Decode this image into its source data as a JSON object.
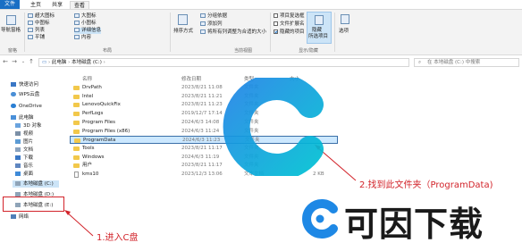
{
  "ribbon": {
    "tabs": [
      "文件",
      "主页",
      "共享",
      "查看"
    ],
    "pane_group": {
      "nav_pane": "导航窗格",
      "label": "窗格"
    },
    "layout_group": {
      "items": [
        "超大图标",
        "大图标",
        "中图标",
        "小图标",
        "列表",
        "详细信息",
        "平铺",
        "内容"
      ],
      "label": "布局"
    },
    "current_view": {
      "sort": "排序方式",
      "group_by": "分组依据",
      "add_columns": "添加列",
      "fit_columns": "将所有列调整为合适的大小",
      "label": "当前视图"
    },
    "show_hide": {
      "item_checkbox": "项目复选框",
      "file_ext": "文件扩展名",
      "hidden_items": "隐藏的项目",
      "hide_selected": "隐藏",
      "hide_selected_2": "所选项目",
      "label": "显示/隐藏"
    },
    "options": "选项"
  },
  "address": {
    "path": [
      "此电脑",
      "本地磁盘 (C:)"
    ],
    "search_placeholder": "在 本地磁盘 (C:) 中搜索"
  },
  "nav": {
    "items": [
      "快速访问",
      "WPS云盘",
      "OneDrive",
      "此电脑",
      "3D 对象",
      "视频",
      "图片",
      "文档",
      "下载",
      "音乐",
      "桌面",
      "本地磁盘 (C:)",
      "本地磁盘 (D:)",
      "本地磁盘 (E:)",
      "网络"
    ]
  },
  "columns": {
    "name": "名称",
    "date": "修改日期",
    "type": "类型",
    "size": "大小"
  },
  "files": [
    {
      "name": "DrvPath",
      "date": "2023/8/21 11:08",
      "type": "文件夹",
      "size": "",
      "kind": "folder"
    },
    {
      "name": "Intel",
      "date": "2023/8/21 11:21",
      "type": "文件夹",
      "size": "",
      "kind": "folder"
    },
    {
      "name": "LenovoQuickFix",
      "date": "2023/8/21 11:23",
      "type": "文件夹",
      "size": "",
      "kind": "folder"
    },
    {
      "name": "PerfLogs",
      "date": "2019/12/7 17:14",
      "type": "文件夹",
      "size": "",
      "kind": "folder"
    },
    {
      "name": "Program Files",
      "date": "2024/6/3 14:08",
      "type": "文件夹",
      "size": "",
      "kind": "folder"
    },
    {
      "name": "Program Files (x86)",
      "date": "2024/6/3 11:24",
      "type": "文件夹",
      "size": "",
      "kind": "folder"
    },
    {
      "name": "ProgramData",
      "date": "2024/6/3 11:23",
      "type": "文件夹",
      "size": "",
      "kind": "folder"
    },
    {
      "name": "Tools",
      "date": "2023/8/21 11:17",
      "type": "文件夹",
      "size": "",
      "kind": "folder"
    },
    {
      "name": "Windows",
      "date": "2024/6/3 11:19",
      "type": "文件夹",
      "size": "",
      "kind": "folder"
    },
    {
      "name": "用户",
      "date": "2023/8/21 11:17",
      "type": "文件夹",
      "size": "",
      "kind": "folder"
    },
    {
      "name": "kms10",
      "date": "2023/12/3 13:06",
      "type": "文本文档",
      "size": "2 KB",
      "kind": "file"
    }
  ],
  "annotations": {
    "step1": "1.进入C盘",
    "step2": "2.找到此文件夹（ProgramData)"
  },
  "watermark": {
    "text": "可因下载"
  },
  "colors": {
    "accent": "#1a6fc4",
    "annotation": "#d2232a",
    "watermark_blue": "#1e88e5"
  }
}
